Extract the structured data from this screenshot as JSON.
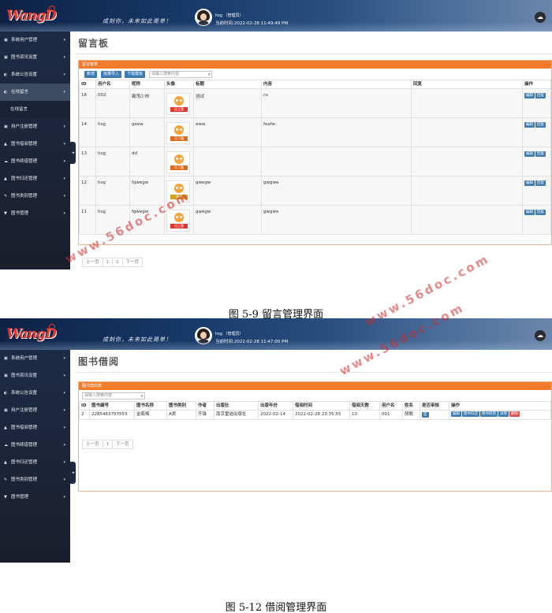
{
  "shared": {
    "logo": "Wang",
    "logo_letter": "D",
    "slogan": "成刻你，未来如此简单！",
    "user_name": "hsg",
    "user_role": "（管理员）",
    "icons": {
      "cloud": "cloud-icon",
      "collapse": "chevron-left-icon",
      "search": "search-icon"
    },
    "colors": {
      "accent": "#f27b2c",
      "button": "#3d7bb3",
      "danger": "#d9534f",
      "sidebar": "#1d2438"
    }
  },
  "shot1": {
    "time_label": "当前时间:",
    "time_value": "2022-02-28 11:49:49 PM",
    "sidebar": [
      {
        "icon": "▣",
        "label": "系统用户管理"
      },
      {
        "icon": "▣",
        "label": "图书资讯设置"
      },
      {
        "icon": "◐",
        "label": "系统公告设置"
      },
      {
        "icon": "◐",
        "label": "在线留言",
        "active": true
      },
      {
        "icon": "",
        "label": "在线留言",
        "sub": true
      },
      {
        "icon": "▣",
        "label": "用户注册管理"
      },
      {
        "icon": "▲",
        "label": "图书借阅管理"
      },
      {
        "icon": "☁",
        "label": "图书续借管理"
      },
      {
        "icon": "▲",
        "label": "图书归还管理"
      },
      {
        "icon": "✎",
        "label": "图书类别管理"
      },
      {
        "icon": "▼",
        "label": "图书管理"
      }
    ],
    "page_title": "留言板",
    "panel_title": "留言板表",
    "buttons": {
      "add": "新增",
      "import": "批量导入",
      "download": "下载模板"
    },
    "search_placeholder": "请输入搜索内容",
    "columns": [
      "ID",
      "用户名",
      "昵称",
      "头像",
      "标题",
      "内容",
      "回复",
      "操作"
    ],
    "rows": [
      {
        "id": "16",
        "username": "002",
        "nickname": "霸荡少帅",
        "avatar_tag": "优之惠",
        "title": "测试",
        "content": "cs",
        "reply": ""
      },
      {
        "id": "14",
        "username": "hsg",
        "nickname": "geew",
        "avatar_tag": "乐了趣",
        "title": "eww",
        "content": "feefw",
        "reply": ""
      },
      {
        "id": "13",
        "username": "hsg",
        "nickname": "dd",
        "avatar_tag": "乐了趣",
        "title": "",
        "content": "",
        "reply": ""
      },
      {
        "id": "12",
        "username": "hsg",
        "nickname": "fgwegw",
        "avatar_tag": "多彩",
        "title": "gwegw",
        "content": "gwgwe",
        "reply": ""
      },
      {
        "id": "11",
        "username": "hsg",
        "nickname": "fgwegw",
        "avatar_tag": "优之惠",
        "title": "gwegw",
        "content": "gwgwe",
        "reply": ""
      }
    ],
    "row_actions": [
      "编辑",
      "回复"
    ],
    "pager": [
      "上一页",
      "1",
      "2",
      "下一页"
    ],
    "caption": "图 5-9   留言管理界面"
  },
  "shot2": {
    "time_label": "当前时间:",
    "time_value": "2022-02-28 11:47:00 PM",
    "sidebar": [
      {
        "icon": "▣",
        "label": "系统用户管理"
      },
      {
        "icon": "▣",
        "label": "图书资讯设置"
      },
      {
        "icon": "◐",
        "label": "系统公告设置"
      },
      {
        "icon": "▣",
        "label": "用户注册管理"
      },
      {
        "icon": "▲",
        "label": "图书借阅管理"
      },
      {
        "icon": "☁",
        "label": "图书续借管理"
      },
      {
        "icon": "▲",
        "label": "图书归还管理"
      },
      {
        "icon": "✎",
        "label": "图书类别管理"
      },
      {
        "icon": "▼",
        "label": "图书管理"
      }
    ],
    "page_title": "图书借阅",
    "panel_title": "图书借阅表",
    "search_placeholder": "请输入搜索内容",
    "columns": [
      "ID",
      "图书编号",
      "图书名称",
      "图书类别",
      "作者",
      "出版社",
      "出版年份",
      "借阅时间",
      "借阅天数",
      "用户名",
      "姓名",
      "是否审核",
      "操作"
    ],
    "rows": [
      {
        "id": "2",
        "book_no": "2285463757553",
        "book_name": "金瓶梅",
        "category": "A类",
        "author": "齐锋",
        "publisher": "南京雷迪出版社",
        "year": "2022-02-14",
        "borrow_time": "2022-02-28 23:35:55",
        "days": "10",
        "username": "001",
        "name": "胡歌",
        "audited": "是"
      }
    ],
    "row_actions": [
      "编辑",
      "图书归还",
      "图书续借",
      "详情",
      "删除"
    ],
    "pager": [
      "上一页",
      "1",
      "下一页"
    ],
    "caption": "图 5-12   借阅管理界面"
  },
  "watermarks": [
    "www.56doc.com",
    "www.56doc.com",
    "www.56doc.com"
  ]
}
